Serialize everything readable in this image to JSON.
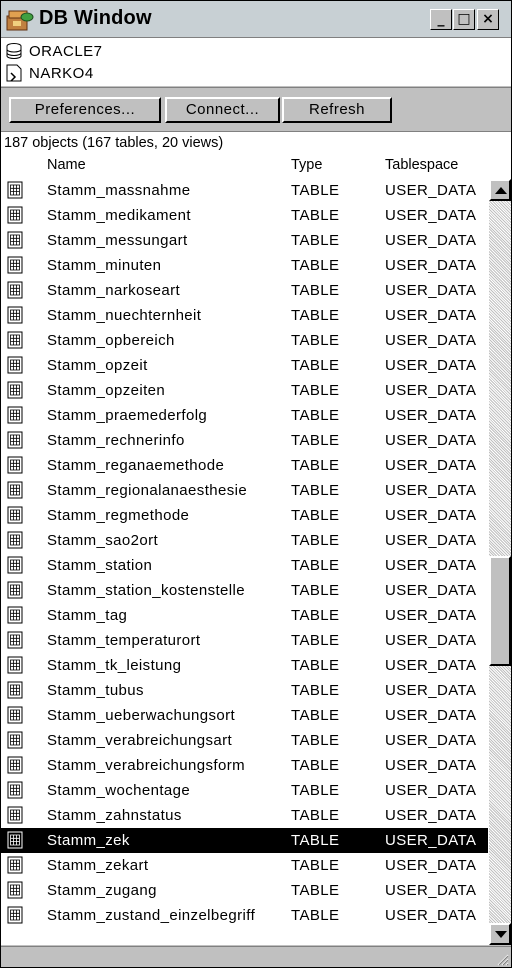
{
  "window": {
    "title": "DB Window",
    "controls": {
      "minimize": "_",
      "maximize": "□",
      "close": "×"
    }
  },
  "connection": {
    "server": "ORACLE7",
    "user": "NARKO4",
    "server_icon": "database-icon",
    "user_icon": "user-schema-icon"
  },
  "toolbar": {
    "preferences_label": "Preferences...",
    "connect_label": "Connect...",
    "refresh_label": "Refresh"
  },
  "summary": "187 objects (167 tables, 20 views)",
  "columns": {
    "name": "Name",
    "type": "Type",
    "tablespace": "Tablespace"
  },
  "row_icon": "table-icon",
  "rows": [
    {
      "name": "Stamm_massnahme",
      "type": "TABLE",
      "tablespace": "USER_DATA"
    },
    {
      "name": "Stamm_medikament",
      "type": "TABLE",
      "tablespace": "USER_DATA"
    },
    {
      "name": "Stamm_messungart",
      "type": "TABLE",
      "tablespace": "USER_DATA"
    },
    {
      "name": "Stamm_minuten",
      "type": "TABLE",
      "tablespace": "USER_DATA"
    },
    {
      "name": "Stamm_narkoseart",
      "type": "TABLE",
      "tablespace": "USER_DATA"
    },
    {
      "name": "Stamm_nuechternheit",
      "type": "TABLE",
      "tablespace": "USER_DATA"
    },
    {
      "name": "Stamm_opbereich",
      "type": "TABLE",
      "tablespace": "USER_DATA"
    },
    {
      "name": "Stamm_opzeit",
      "type": "TABLE",
      "tablespace": "USER_DATA"
    },
    {
      "name": "Stamm_opzeiten",
      "type": "TABLE",
      "tablespace": "USER_DATA"
    },
    {
      "name": "Stamm_praemederfolg",
      "type": "TABLE",
      "tablespace": "USER_DATA"
    },
    {
      "name": "Stamm_rechnerinfo",
      "type": "TABLE",
      "tablespace": "USER_DATA"
    },
    {
      "name": "Stamm_reganaemethode",
      "type": "TABLE",
      "tablespace": "USER_DATA"
    },
    {
      "name": "Stamm_regionalanaesthesie",
      "type": "TABLE",
      "tablespace": "USER_DATA"
    },
    {
      "name": "Stamm_regmethode",
      "type": "TABLE",
      "tablespace": "USER_DATA"
    },
    {
      "name": "Stamm_sao2ort",
      "type": "TABLE",
      "tablespace": "USER_DATA"
    },
    {
      "name": "Stamm_station",
      "type": "TABLE",
      "tablespace": "USER_DATA"
    },
    {
      "name": "Stamm_station_kostenstelle",
      "type": "TABLE",
      "tablespace": "USER_DATA"
    },
    {
      "name": "Stamm_tag",
      "type": "TABLE",
      "tablespace": "USER_DATA"
    },
    {
      "name": "Stamm_temperaturort",
      "type": "TABLE",
      "tablespace": "USER_DATA"
    },
    {
      "name": "Stamm_tk_leistung",
      "type": "TABLE",
      "tablespace": "USER_DATA"
    },
    {
      "name": "Stamm_tubus",
      "type": "TABLE",
      "tablespace": "USER_DATA"
    },
    {
      "name": "Stamm_ueberwachungsort",
      "type": "TABLE",
      "tablespace": "USER_DATA"
    },
    {
      "name": "Stamm_verabreichungsart",
      "type": "TABLE",
      "tablespace": "USER_DATA"
    },
    {
      "name": "Stamm_verabreichungsform",
      "type": "TABLE",
      "tablespace": "USER_DATA"
    },
    {
      "name": "Stamm_wochentage",
      "type": "TABLE",
      "tablespace": "USER_DATA"
    },
    {
      "name": "Stamm_zahnstatus",
      "type": "TABLE",
      "tablespace": "USER_DATA"
    },
    {
      "name": "Stamm_zek",
      "type": "TABLE",
      "tablespace": "USER_DATA",
      "selected": true
    },
    {
      "name": "Stamm_zekart",
      "type": "TABLE",
      "tablespace": "USER_DATA"
    },
    {
      "name": "Stamm_zugang",
      "type": "TABLE",
      "tablespace": "USER_DATA"
    },
    {
      "name": "Stamm_zustand_einzelbegriff",
      "type": "TABLE",
      "tablespace": "USER_DATA"
    }
  ],
  "scrollbar": {
    "position_fraction": 0.58
  },
  "colors": {
    "selection_bg": "#000000",
    "selection_fg": "#ffffff",
    "chrome": "#c0c0c0"
  }
}
